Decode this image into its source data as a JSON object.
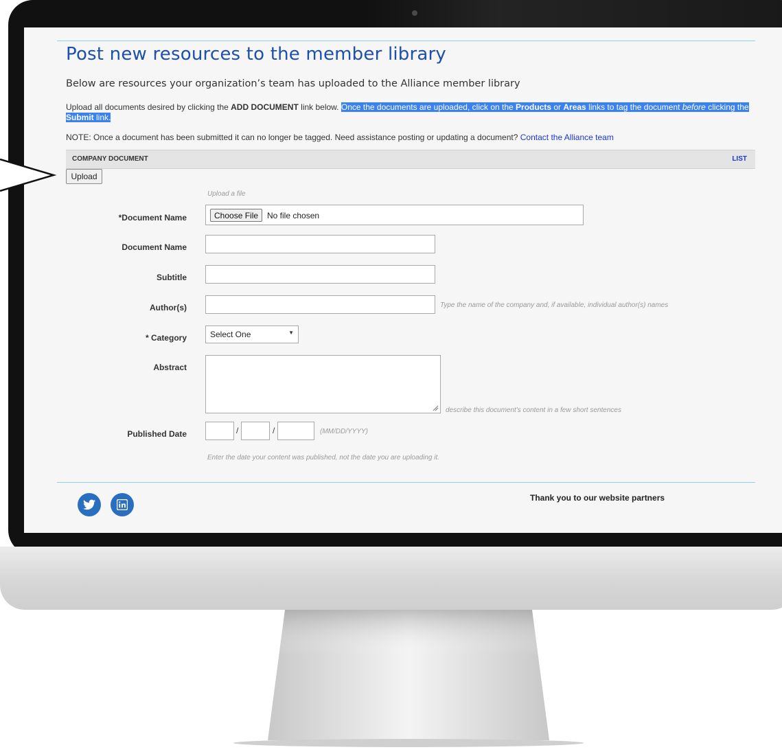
{
  "page": {
    "title": "Post new resources to the member library",
    "subtitle": "Below are resources your organization’s team has uploaded to the Alliance member library"
  },
  "instructions": {
    "part1": "Upload all documents desired by clicking the ",
    "add_document": "ADD DOCUMENT",
    "part2": " link below. ",
    "hl1": "Once the documents are uploaded, click on the ",
    "products": "Products",
    "or": " or ",
    "areas": "Areas",
    "hl2": " links to tag the document ",
    "before": "before",
    "hl3": " clicking the ",
    "submit": "Submit",
    "hl4": " link."
  },
  "note": {
    "text": "NOTE: Once a document has been submitted it can no longer be tagged.  Need assistance posting or updating a document?  ",
    "link": "Contact the Alliance team"
  },
  "section": {
    "title": "COMPANY DOCUMENT",
    "list_link": "LIST"
  },
  "upload_button": "Upload",
  "upload_hint": "Upload a file",
  "form": {
    "file": {
      "label": "*Document Name",
      "button": "Choose File",
      "status": "No file chosen"
    },
    "document_name": {
      "label": "Document Name",
      "value": ""
    },
    "subtitle": {
      "label": "Subtitle",
      "value": ""
    },
    "authors": {
      "label": "Author(s)",
      "value": "",
      "hint": "Type the name of the company and, if available, individual author(s) names"
    },
    "category": {
      "label": "* Category",
      "selected": "Select One"
    },
    "abstract": {
      "label": "Abstract",
      "value": "",
      "hint": "describe this document's content in a few short sentences"
    },
    "published_date": {
      "label": "Published Date",
      "format_hint": "(MM/DD/YYYY)",
      "separator": "/",
      "note": "Enter the date your content was published, not the date you are uploading it."
    }
  },
  "footer": {
    "partners": "Thank you to our website partners",
    "social": [
      "twitter-icon",
      "linkedin-icon"
    ]
  },
  "colors": {
    "title": "#1d4fae",
    "link": "#1a37d6",
    "highlight": "#3b82f0",
    "social": "#2a6ec0",
    "rule": "#8dd3e6"
  }
}
